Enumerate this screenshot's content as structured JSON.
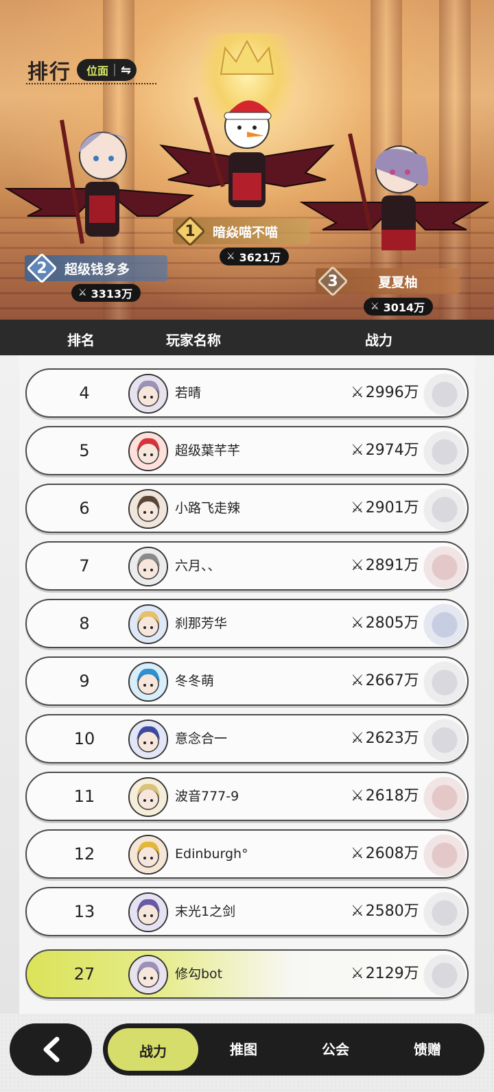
{
  "header": {
    "title": "排行",
    "mode_label": "位面",
    "swap_icon": "swap-icon"
  },
  "podium": [
    {
      "rank": "1",
      "name": "暗焱喵不喵",
      "power": "3621万"
    },
    {
      "rank": "2",
      "name": "超级钱多多",
      "power": "3313万"
    },
    {
      "rank": "3",
      "name": "夏夏柚",
      "power": "3014万"
    }
  ],
  "power_icon": "crossed-swords-icon",
  "power_glyph": "⚔",
  "table": {
    "columns": [
      "排名",
      "玩家名称",
      "战力"
    ]
  },
  "rows": [
    {
      "rank": "4",
      "name": "若晴",
      "power": "2996万"
    },
    {
      "rank": "5",
      "name": "超级葉芊芊",
      "power": "2974万"
    },
    {
      "rank": "6",
      "name": "小路飞走辣",
      "power": "2901万"
    },
    {
      "rank": "7",
      "name": "六月、、",
      "power": "2891万"
    },
    {
      "rank": "8",
      "name": "刹那芳华",
      "power": "2805万"
    },
    {
      "rank": "9",
      "name": "冬冬萌",
      "power": "2667万"
    },
    {
      "rank": "10",
      "name": "意念合一",
      "power": "2623万"
    },
    {
      "rank": "11",
      "name": "波音777-9",
      "power": "2618万"
    },
    {
      "rank": "12",
      "name": "Edinburgh°",
      "power": "2608万"
    },
    {
      "rank": "13",
      "name": "末光1之剑",
      "power": "2580万"
    }
  ],
  "self_row": {
    "rank": "27",
    "name": "修勾bot",
    "power": "2129万"
  },
  "bottom_nav": {
    "back_icon": "chevron-left-icon",
    "tabs": [
      "战力",
      "推图",
      "公会",
      "馈赠"
    ],
    "active_tab": "战力"
  },
  "colors": {
    "accent": "#d6dd6a",
    "dark": "#1e1e1e",
    "header_bg": "#2b2b2b"
  }
}
